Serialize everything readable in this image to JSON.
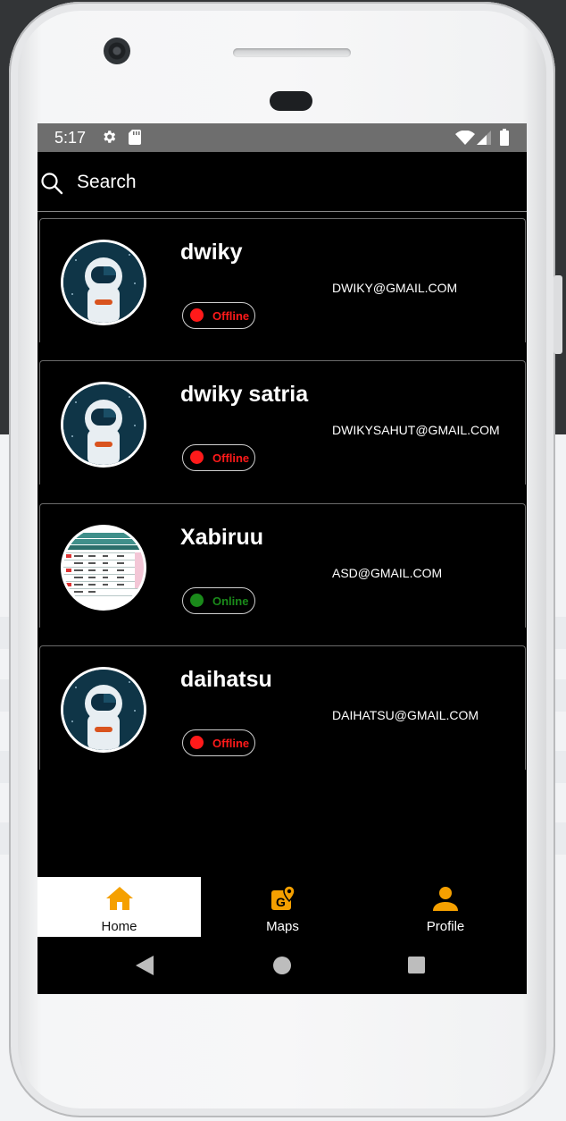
{
  "status_bar": {
    "time": "5:17",
    "icons": [
      "gear-icon",
      "sd-card-icon",
      "wifi-icon",
      "signal-icon",
      "battery-icon"
    ]
  },
  "search": {
    "label": "Search",
    "icon": "search-icon"
  },
  "users": [
    {
      "name": "dwiky",
      "email": "DWIKY@GMAIL.COM",
      "status": "Offline",
      "avatar": "astronaut"
    },
    {
      "name": "dwiky satria",
      "email": "DWIKYSAHUT@GMAIL.COM",
      "status": "Offline",
      "avatar": "astronaut"
    },
    {
      "name": "Xabiruu",
      "email": "ASD@GMAIL.COM",
      "status": "Online",
      "avatar": "table-image"
    },
    {
      "name": "daihatsu",
      "email": "DAIHATSU@GMAIL.COM",
      "status": "Offline",
      "avatar": "astronaut"
    }
  ],
  "status_colors": {
    "Offline": "#ff1a1a",
    "Online": "#1a8a1a"
  },
  "bottom_nav": [
    {
      "label": "Home",
      "icon": "home-icon",
      "selected": true
    },
    {
      "label": "Maps",
      "icon": "map-icon",
      "selected": false
    },
    {
      "label": "Profile",
      "icon": "person-icon",
      "selected": false
    }
  ],
  "accent_color": "#f5a000",
  "system_nav": [
    "back-icon",
    "home-circle-icon",
    "recents-icon"
  ]
}
